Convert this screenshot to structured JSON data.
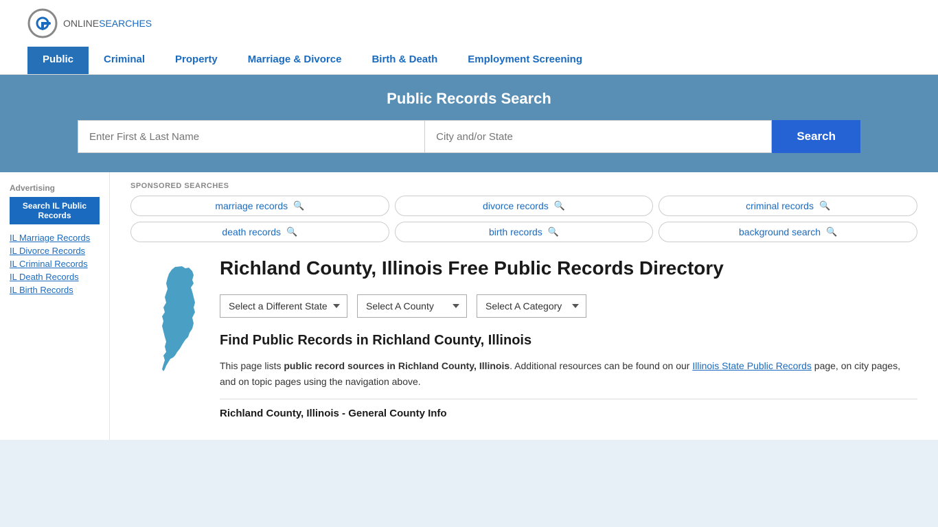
{
  "header": {
    "logo_online": "ONLINE",
    "logo_searches": "SEARCHES",
    "nav": [
      {
        "label": "Public",
        "active": true
      },
      {
        "label": "Criminal",
        "active": false
      },
      {
        "label": "Property",
        "active": false
      },
      {
        "label": "Marriage & Divorce",
        "active": false
      },
      {
        "label": "Birth & Death",
        "active": false
      },
      {
        "label": "Employment Screening",
        "active": false
      }
    ]
  },
  "search_hero": {
    "title": "Public Records Search",
    "name_placeholder": "Enter First & Last Name",
    "location_placeholder": "City and/or State",
    "search_button": "Search"
  },
  "sponsored": {
    "label": "SPONSORED SEARCHES",
    "items": [
      {
        "text": "marriage records"
      },
      {
        "text": "divorce records"
      },
      {
        "text": "criminal records"
      },
      {
        "text": "death records"
      },
      {
        "text": "birth records"
      },
      {
        "text": "background search"
      }
    ]
  },
  "sidebar": {
    "ad_label": "Advertising",
    "search_il_btn": "Search IL Public Records",
    "links": [
      {
        "text": "IL Marriage Records"
      },
      {
        "text": "IL Divorce Records"
      },
      {
        "text": "IL Criminal Records"
      },
      {
        "text": "IL Death Records"
      },
      {
        "text": "IL Birth Records"
      }
    ]
  },
  "main": {
    "page_heading": "Richland County, Illinois Free Public Records Directory",
    "dropdowns": {
      "state": "Select a Different State",
      "county": "Select A County",
      "category": "Select A Category"
    },
    "find_heading": "Find Public Records in Richland County, Illinois",
    "find_text_part1": "This page lists ",
    "find_bold": "public record sources in Richland County, Illinois",
    "find_text_part2": ". Additional resources can be found on our ",
    "find_link_text": "Illinois State Public Records",
    "find_text_part3": " page, on city pages, and on topic pages using the navigation above.",
    "general_info_heading": "Richland County, Illinois - General County Info"
  }
}
